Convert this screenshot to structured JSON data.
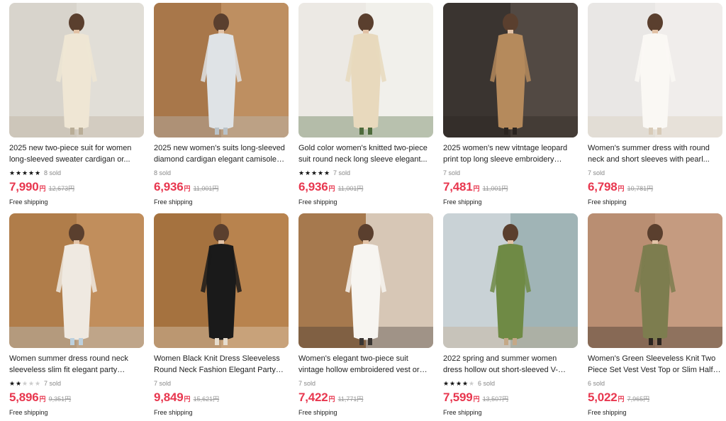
{
  "products": [
    {
      "title": "2025 new two-piece suit for women long-sleeved sweater cardigan or...",
      "rating": 5,
      "sold": "8 sold",
      "price": "7,990",
      "currency": "円",
      "orig": "12,673",
      "orig_currency": "円",
      "shipping": "Free shipping",
      "colors": {
        "bg": "#d8d4cc",
        "wall": "#e6e2db",
        "garment": "#efe6d4",
        "accent": "#b9ad97"
      }
    },
    {
      "title": "2025 new women's suits long-sleeved diamond cardigan elegant camisole or...",
      "rating": 0,
      "sold": "8 sold",
      "price": "6,936",
      "currency": "円",
      "orig": "11,001",
      "orig_currency": "円",
      "shipping": "Free shipping",
      "colors": {
        "bg": "#a8774a",
        "wall": "#c89a6b",
        "garment": "#dfe3e6",
        "accent": "#b9c2c8"
      }
    },
    {
      "title": "Gold color women's knitted two-piece suit round neck long sleeve elegant...",
      "rating": 5,
      "sold": "7 sold",
      "price": "6,936",
      "currency": "円",
      "orig": "11,001",
      "orig_currency": "円",
      "shipping": "Free shipping",
      "colors": {
        "bg": "#ece9e4",
        "wall": "#f4f2ee",
        "garment": "#e8d9bd",
        "accent": "#4e6b3c"
      }
    },
    {
      "title": "2025 women's new vitntage leopard print top long sleeve embroidery casu...",
      "rating": 0,
      "sold": "7 sold",
      "price": "7,481",
      "currency": "円",
      "orig": "11,001",
      "orig_currency": "円",
      "shipping": "Free shipping",
      "colors": {
        "bg": "#3a3430",
        "wall": "#5c534c",
        "garment": "#b58a5c",
        "accent": "#2a2420"
      }
    },
    {
      "title": "Women's summer dress with round neck and short sleeves with pearl...",
      "rating": 0,
      "sold": "7 sold",
      "price": "6,798",
      "currency": "円",
      "orig": "10,781",
      "orig_currency": "円",
      "shipping": "Free shipping",
      "colors": {
        "bg": "#e9e7e5",
        "wall": "#f2f0ee",
        "garment": "#faf8f4",
        "accent": "#d8cbb8"
      }
    },
    {
      "title": "Women summer dress round neck sleeveless slim fit elegant party dress...",
      "rating": 2,
      "sold": "7 sold",
      "price": "5,896",
      "currency": "円",
      "orig": "9,351",
      "orig_currency": "円",
      "shipping": "Free shipping",
      "colors": {
        "bg": "#b07d4a",
        "wall": "#c99564",
        "garment": "#efe9e1",
        "accent": "#bcd0de"
      }
    },
    {
      "title": "Women Black Knit Dress Sleeveless Round Neck Fashion Elegant Party Ma...",
      "rating": 0,
      "sold": "7 sold",
      "price": "9,849",
      "currency": "円",
      "orig": "15,621",
      "orig_currency": "円",
      "shipping": "Free shipping",
      "colors": {
        "bg": "#a5723f",
        "wall": "#c08a55",
        "garment": "#1a1a1a",
        "accent": "#e6dccd"
      }
    },
    {
      "title": "Women's elegant two-piece suit vintage hollow embroidered vest or slim...",
      "rating": 0,
      "sold": "7 sold",
      "price": "7,422",
      "currency": "円",
      "orig": "11,771",
      "orig_currency": "円",
      "shipping": "Free shipping",
      "colors": {
        "bg": "#a6794e",
        "wall": "#ece8e3",
        "garment": "#f7f5f1",
        "accent": "#3a3532"
      }
    },
    {
      "title": "2022 spring and summer women dress hollow out short-sleeved V-neck...",
      "rating": 4,
      "sold": "6 sold",
      "price": "7,599",
      "currency": "円",
      "orig": "13,507",
      "orig_currency": "円",
      "shipping": "Free shipping",
      "colors": {
        "bg": "#c9d2d6",
        "wall": "#8fa7a8",
        "garment": "#6f8a45",
        "accent": "#c4a887"
      }
    },
    {
      "title": "Women's Green Sleeveless Knit Two Piece Set Vest Vest Top or Slim Half Skirt",
      "rating": 0,
      "sold": "6 sold",
      "price": "5,022",
      "currency": "円",
      "orig": "7,965",
      "orig_currency": "円",
      "shipping": "Free shipping",
      "colors": {
        "bg": "#b98e72",
        "wall": "#caa186",
        "garment": "#7d7d4f",
        "accent": "#2b2420"
      }
    }
  ]
}
